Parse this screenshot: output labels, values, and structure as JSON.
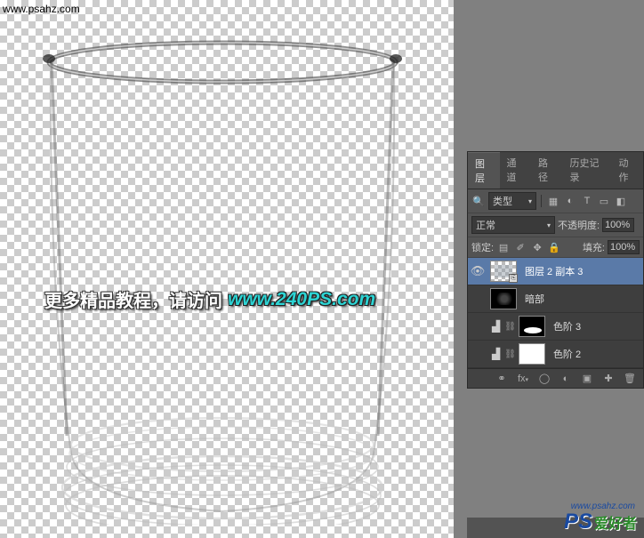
{
  "canvas": {
    "overlay_text_1": "更多精品教程，请访问",
    "overlay_text_2": "www.240PS.com"
  },
  "panel": {
    "tabs": [
      {
        "label": "图层",
        "name": "tab-layers",
        "active": true
      },
      {
        "label": "通道",
        "name": "tab-channels",
        "active": false
      },
      {
        "label": "路径",
        "name": "tab-paths",
        "active": false
      },
      {
        "label": "历史记录",
        "name": "tab-history",
        "active": false
      },
      {
        "label": "动作",
        "name": "tab-actions",
        "active": false
      }
    ],
    "filter_label": "类型",
    "blend_mode": "正常",
    "opacity_label": "不透明度:",
    "opacity_value": "100%",
    "lock_label": "锁定:",
    "fill_label": "填充:",
    "fill_value": "100%"
  },
  "layers": [
    {
      "name": "图层 2 副本 3",
      "visible": true,
      "selected": true,
      "kind": "smart"
    },
    {
      "name": "暗部",
      "visible": false,
      "selected": false,
      "kind": "image-dark"
    },
    {
      "name": "色阶 3",
      "visible": false,
      "selected": false,
      "kind": "levels-mask-black"
    },
    {
      "name": "色阶 2",
      "visible": false,
      "selected": false,
      "kind": "levels-mask-white"
    }
  ],
  "watermark": {
    "top_left": "www.psahz.com",
    "ps": "PS",
    "txt": "爱好者",
    "url": "www.psahz.com"
  }
}
